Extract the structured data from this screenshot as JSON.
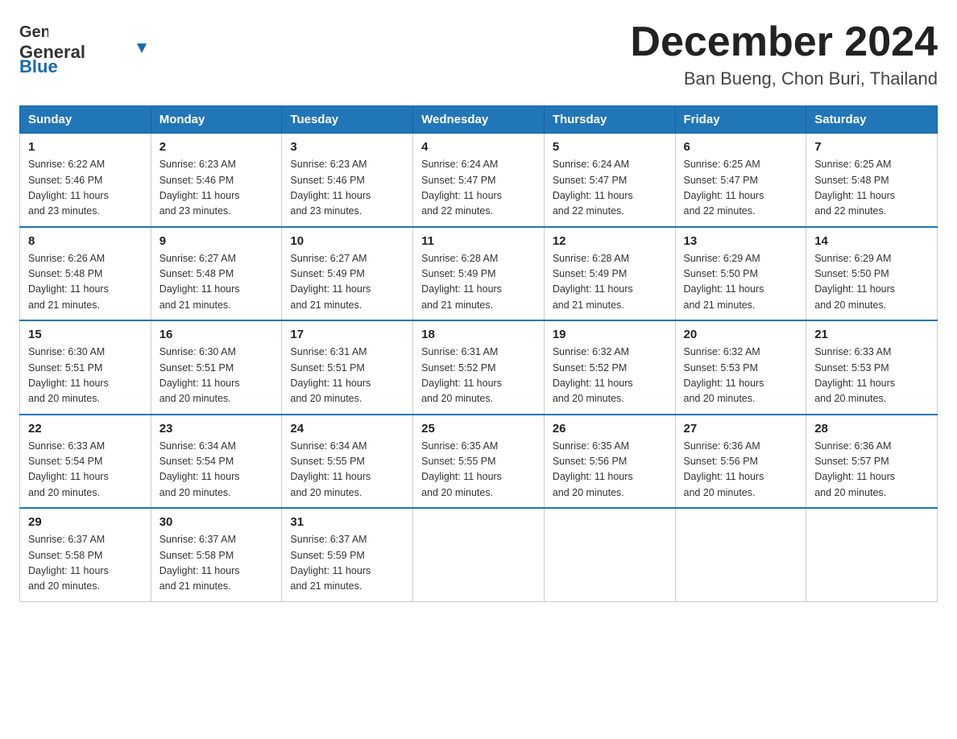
{
  "header": {
    "logo_general": "General",
    "logo_blue": "Blue",
    "title": "December 2024",
    "subtitle": "Ban Bueng, Chon Buri, Thailand"
  },
  "days_of_week": [
    "Sunday",
    "Monday",
    "Tuesday",
    "Wednesday",
    "Thursday",
    "Friday",
    "Saturday"
  ],
  "weeks": [
    [
      {
        "day": "1",
        "sunrise": "6:22 AM",
        "sunset": "5:46 PM",
        "daylight": "11 hours and 23 minutes."
      },
      {
        "day": "2",
        "sunrise": "6:23 AM",
        "sunset": "5:46 PM",
        "daylight": "11 hours and 23 minutes."
      },
      {
        "day": "3",
        "sunrise": "6:23 AM",
        "sunset": "5:46 PM",
        "daylight": "11 hours and 23 minutes."
      },
      {
        "day": "4",
        "sunrise": "6:24 AM",
        "sunset": "5:47 PM",
        "daylight": "11 hours and 22 minutes."
      },
      {
        "day": "5",
        "sunrise": "6:24 AM",
        "sunset": "5:47 PM",
        "daylight": "11 hours and 22 minutes."
      },
      {
        "day": "6",
        "sunrise": "6:25 AM",
        "sunset": "5:47 PM",
        "daylight": "11 hours and 22 minutes."
      },
      {
        "day": "7",
        "sunrise": "6:25 AM",
        "sunset": "5:48 PM",
        "daylight": "11 hours and 22 minutes."
      }
    ],
    [
      {
        "day": "8",
        "sunrise": "6:26 AM",
        "sunset": "5:48 PM",
        "daylight": "11 hours and 21 minutes."
      },
      {
        "day": "9",
        "sunrise": "6:27 AM",
        "sunset": "5:48 PM",
        "daylight": "11 hours and 21 minutes."
      },
      {
        "day": "10",
        "sunrise": "6:27 AM",
        "sunset": "5:49 PM",
        "daylight": "11 hours and 21 minutes."
      },
      {
        "day": "11",
        "sunrise": "6:28 AM",
        "sunset": "5:49 PM",
        "daylight": "11 hours and 21 minutes."
      },
      {
        "day": "12",
        "sunrise": "6:28 AM",
        "sunset": "5:49 PM",
        "daylight": "11 hours and 21 minutes."
      },
      {
        "day": "13",
        "sunrise": "6:29 AM",
        "sunset": "5:50 PM",
        "daylight": "11 hours and 21 minutes."
      },
      {
        "day": "14",
        "sunrise": "6:29 AM",
        "sunset": "5:50 PM",
        "daylight": "11 hours and 20 minutes."
      }
    ],
    [
      {
        "day": "15",
        "sunrise": "6:30 AM",
        "sunset": "5:51 PM",
        "daylight": "11 hours and 20 minutes."
      },
      {
        "day": "16",
        "sunrise": "6:30 AM",
        "sunset": "5:51 PM",
        "daylight": "11 hours and 20 minutes."
      },
      {
        "day": "17",
        "sunrise": "6:31 AM",
        "sunset": "5:51 PM",
        "daylight": "11 hours and 20 minutes."
      },
      {
        "day": "18",
        "sunrise": "6:31 AM",
        "sunset": "5:52 PM",
        "daylight": "11 hours and 20 minutes."
      },
      {
        "day": "19",
        "sunrise": "6:32 AM",
        "sunset": "5:52 PM",
        "daylight": "11 hours and 20 minutes."
      },
      {
        "day": "20",
        "sunrise": "6:32 AM",
        "sunset": "5:53 PM",
        "daylight": "11 hours and 20 minutes."
      },
      {
        "day": "21",
        "sunrise": "6:33 AM",
        "sunset": "5:53 PM",
        "daylight": "11 hours and 20 minutes."
      }
    ],
    [
      {
        "day": "22",
        "sunrise": "6:33 AM",
        "sunset": "5:54 PM",
        "daylight": "11 hours and 20 minutes."
      },
      {
        "day": "23",
        "sunrise": "6:34 AM",
        "sunset": "5:54 PM",
        "daylight": "11 hours and 20 minutes."
      },
      {
        "day": "24",
        "sunrise": "6:34 AM",
        "sunset": "5:55 PM",
        "daylight": "11 hours and 20 minutes."
      },
      {
        "day": "25",
        "sunrise": "6:35 AM",
        "sunset": "5:55 PM",
        "daylight": "11 hours and 20 minutes."
      },
      {
        "day": "26",
        "sunrise": "6:35 AM",
        "sunset": "5:56 PM",
        "daylight": "11 hours and 20 minutes."
      },
      {
        "day": "27",
        "sunrise": "6:36 AM",
        "sunset": "5:56 PM",
        "daylight": "11 hours and 20 minutes."
      },
      {
        "day": "28",
        "sunrise": "6:36 AM",
        "sunset": "5:57 PM",
        "daylight": "11 hours and 20 minutes."
      }
    ],
    [
      {
        "day": "29",
        "sunrise": "6:37 AM",
        "sunset": "5:58 PM",
        "daylight": "11 hours and 20 minutes."
      },
      {
        "day": "30",
        "sunrise": "6:37 AM",
        "sunset": "5:58 PM",
        "daylight": "11 hours and 21 minutes."
      },
      {
        "day": "31",
        "sunrise": "6:37 AM",
        "sunset": "5:59 PM",
        "daylight": "11 hours and 21 minutes."
      },
      null,
      null,
      null,
      null
    ]
  ],
  "labels": {
    "sunrise": "Sunrise:",
    "sunset": "Sunset:",
    "daylight": "Daylight:"
  }
}
